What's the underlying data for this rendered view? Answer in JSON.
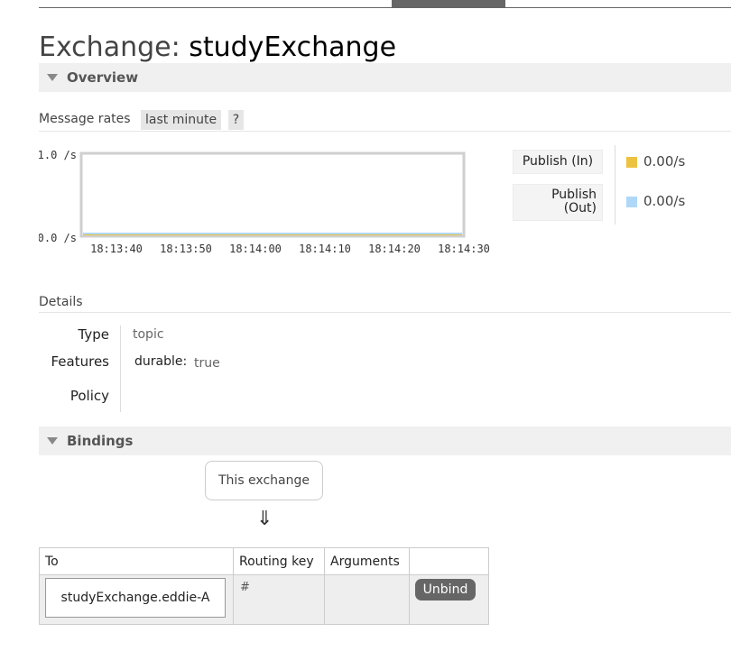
{
  "page": {
    "title_prefix": "Exchange: ",
    "title_name": "studyExchange"
  },
  "overview": {
    "header": "Overview",
    "message_rates_label": "Message rates",
    "range": "last minute",
    "help": "?",
    "legend": [
      {
        "label": "Publish (In)",
        "value": "0.00/s",
        "color": "#edc240"
      },
      {
        "label_line1": "Publish",
        "label_line2": "(Out)",
        "value": "0.00/s",
        "color": "#afd8f8"
      }
    ]
  },
  "chart_data": {
    "type": "line",
    "y_ticks": [
      "1.0 /s",
      "0.0 /s"
    ],
    "ylim": [
      0,
      1
    ],
    "x_ticks": [
      "18:13:40",
      "18:13:50",
      "18:14:00",
      "18:14:10",
      "18:14:20",
      "18:14:30"
    ],
    "series": [
      {
        "name": "Publish (In)",
        "color": "#edc240",
        "values": [
          0,
          0,
          0,
          0,
          0,
          0
        ]
      },
      {
        "name": "Publish (Out)",
        "color": "#afd8f8",
        "values": [
          0,
          0,
          0,
          0,
          0,
          0
        ]
      }
    ]
  },
  "details": {
    "label": "Details",
    "type_label": "Type",
    "type_value": "topic",
    "features_label": "Features",
    "durable_key": "durable:",
    "durable_value": "true",
    "policy_label": "Policy"
  },
  "bindings": {
    "header": "Bindings",
    "this_exchange": "This exchange",
    "arrow": "⇓",
    "columns": [
      "To",
      "Routing key",
      "Arguments"
    ],
    "rows": [
      {
        "to": "studyExchange.eddie-A",
        "routing_key": "#",
        "arguments": "",
        "action": "Unbind"
      }
    ]
  }
}
